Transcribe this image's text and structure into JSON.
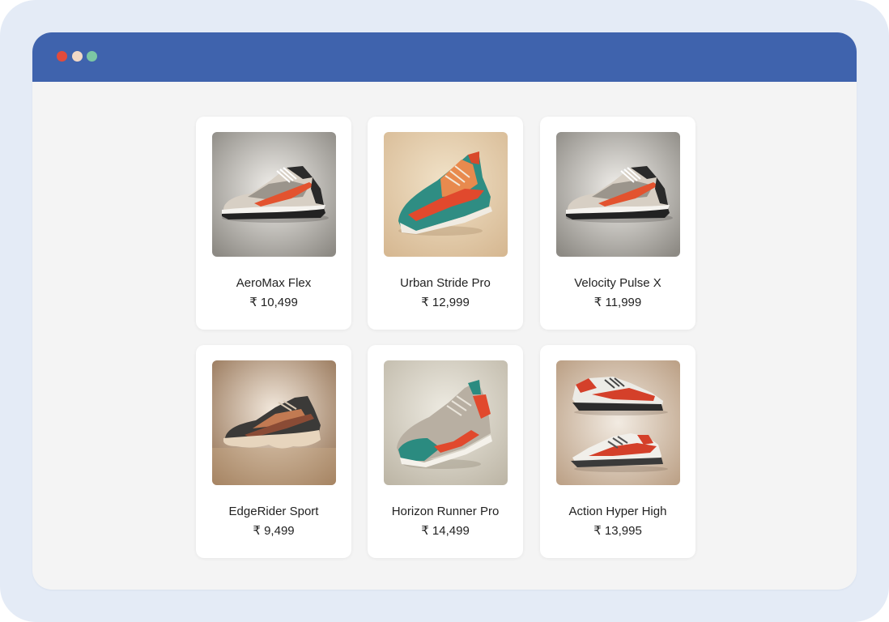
{
  "window": {
    "dots": [
      {
        "name": "close",
        "color": "#e24b3b"
      },
      {
        "name": "minimize",
        "color": "#f2d9c6"
      },
      {
        "name": "maximize",
        "color": "#7cc7a4"
      }
    ]
  },
  "products": [
    {
      "name": "AeroMax Flex",
      "price": "₹ 10,499",
      "image": "sneaker-image"
    },
    {
      "name": "Urban Stride Pro",
      "price": "₹ 12,999",
      "image": "sneaker-image"
    },
    {
      "name": "Velocity Pulse X",
      "price": "₹ 11,999",
      "image": "sneaker-image"
    },
    {
      "name": "EdgeRider Sport",
      "price": "₹ 9,499",
      "image": "sneaker-image"
    },
    {
      "name": "Horizon Runner Pro",
      "price": "₹ 14,499",
      "image": "sneaker-image"
    },
    {
      "name": "Action Hyper High",
      "price": "₹ 13,995",
      "image": "sneaker-pair-image"
    }
  ]
}
